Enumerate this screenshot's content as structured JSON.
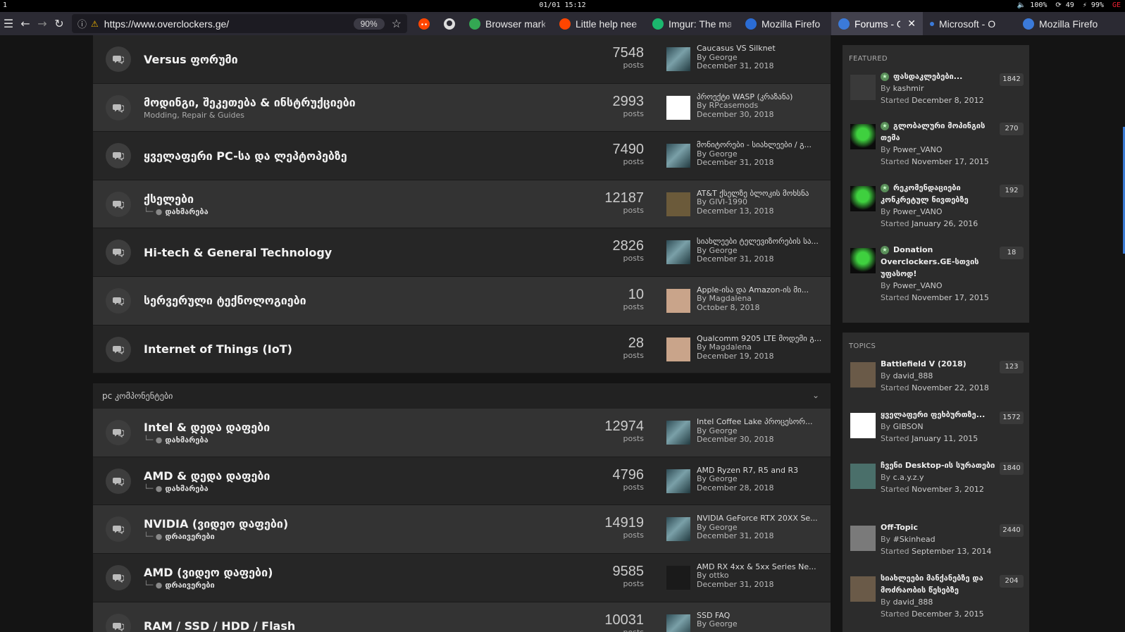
{
  "system": {
    "workspace": "1",
    "clock": "01/01 15:12",
    "volume": "🔈 100%",
    "updates": "⟳ 49",
    "battery": "⚡ 99%",
    "layout": "GE"
  },
  "browser": {
    "url": "https://www.overclockers.ge/",
    "zoom": "90%",
    "tabs": [
      {
        "label": "Browser mark",
        "color": "#34a853",
        "active": false
      },
      {
        "label": "Little help nee",
        "color": "#ff4500",
        "active": false
      },
      {
        "label": "Imgur: The ma",
        "color": "#1bb76e",
        "active": false
      },
      {
        "label": "Mozilla Firefo",
        "color": "#2b6cd4",
        "active": false
      },
      {
        "label": "Forums - O",
        "color": "#3b7ad9",
        "active": true
      },
      {
        "label": "Microsoft - O",
        "color": "#2b2a33",
        "active": false
      },
      {
        "label": "Mozilla Firefo",
        "color": "#3b7ad9",
        "active": false
      }
    ]
  },
  "forums": [
    {
      "title": "Versus ფორუმი",
      "sub": "",
      "subforum": "",
      "count": "7548",
      "count_label": "posts",
      "last_title": "Caucasus VS Silknet",
      "last_by": "By George",
      "last_date": "December 31, 2018",
      "avatar": "#5a7f86"
    },
    {
      "title": "მოდინგი, შეკეთება & ინსტრუქციები",
      "sub": "Modding, Repair & Guides",
      "subforum": "",
      "count": "2993",
      "count_label": "posts",
      "last_title": "პროექტი WASP (კრაზანა)",
      "last_by": "By RPcasemods",
      "last_date": "December 30, 2018",
      "avatar": "#ffffff"
    },
    {
      "title": "ყველაფერი PC-სა და ლეპტოპებზე",
      "sub": "",
      "subforum": "",
      "count": "7490",
      "count_label": "posts",
      "last_title": "მონიტორები - სიახლეები / გ...",
      "last_by": "By George",
      "last_date": "December 31, 2018",
      "avatar": "#5a7f86"
    },
    {
      "title": "ქსელები",
      "sub": "",
      "subforum": "დახმარება",
      "count": "12187",
      "count_label": "posts",
      "last_title": "AT&T ქსელზე ბლოკის მოხსნა",
      "last_by": "By GIVI-1990",
      "last_date": "December 13, 2018",
      "avatar": "#6b5a3a"
    },
    {
      "title": "Hi-tech & General Technology",
      "sub": "",
      "subforum": "",
      "count": "2826",
      "count_label": "posts",
      "last_title": "სიახლეები ტელევიზორების სა...",
      "last_by": "By George",
      "last_date": "December 31, 2018",
      "avatar": "#5a7f86"
    },
    {
      "title": "სერვერული ტექნოლოგიები",
      "sub": "",
      "subforum": "",
      "count": "10",
      "count_label": "posts",
      "last_title": "Apple-ისა და Amazon-ის მი...",
      "last_by": "By Magdalena",
      "last_date": "October 8, 2018",
      "avatar": "#c9a48a"
    },
    {
      "title": "Internet of Things (IoT)",
      "sub": "",
      "subforum": "",
      "count": "28",
      "count_label": "posts",
      "last_title": "Qualcomm 9205 LTE მოდემი გ...",
      "last_by": "By Magdalena",
      "last_date": "December 19, 2018",
      "avatar": "#c9a48a"
    }
  ],
  "category": {
    "title": "pc კომპონენტები"
  },
  "forums2": [
    {
      "title": "Intel & დედა დაფები",
      "sub": "",
      "subforum": "დახმარება",
      "count": "12974",
      "count_label": "posts",
      "last_title": "Intel Coffee Lake პროცესორ...",
      "last_by": "By George",
      "last_date": "December 30, 2018",
      "avatar": "#5a7f86"
    },
    {
      "title": "AMD & დედა დაფები",
      "sub": "",
      "subforum": "დახმარება",
      "count": "4796",
      "count_label": "posts",
      "last_title": "AMD Ryzen R7, R5 and R3",
      "last_by": "By George",
      "last_date": "December 28, 2018",
      "avatar": "#5a7f86"
    },
    {
      "title": "NVIDIA (ვიდეო დაფები)",
      "sub": "",
      "subforum": "დრაივერები",
      "count": "14919",
      "count_label": "posts",
      "last_title": "NVIDIA GeForce RTX 20XX Se...",
      "last_by": "By George",
      "last_date": "December 31, 2018",
      "avatar": "#5a7f86"
    },
    {
      "title": "AMD (ვიდეო დაფები)",
      "sub": "",
      "subforum": "დრაივერები",
      "count": "9585",
      "count_label": "posts",
      "last_title": "AMD RX 4xx & 5xx Series Ne...",
      "last_by": "By ottko",
      "last_date": "December 31, 2018",
      "avatar": "#1a1a1a"
    },
    {
      "title": "RAM / SSD / HDD / Flash",
      "sub": "",
      "subforum": "",
      "count": "10031",
      "count_label": "posts",
      "last_title": "SSD FAQ",
      "last_by": "By George",
      "last_date": "",
      "avatar": "#5a7f86"
    }
  ],
  "featured": {
    "heading": "FEATURED",
    "items": [
      {
        "title": "ფასდაკლებები...",
        "by": "kashmir",
        "started": "December 8, 2012",
        "count": "1842",
        "avatar": "#3a3a3a"
      },
      {
        "title": "გლობალური მოპინგის თემა",
        "by": "Power_VANO",
        "started": "November 17, 2015",
        "count": "270",
        "avatar": "#2faa2f"
      },
      {
        "title": "რეკომენდაციები კონკრეტულ ნივთებზე",
        "by": "Power_VANO",
        "started": "January 26, 2016",
        "count": "192",
        "avatar": "#2faa2f"
      },
      {
        "title": "Donation Overclockers.GE-სთვის უფასოდ!",
        "by": "Power_VANO",
        "started": "November 17, 2015",
        "count": "18",
        "avatar": "#2faa2f"
      }
    ]
  },
  "topics": {
    "heading": "TOPICS",
    "items": [
      {
        "title": "Battlefield V (2018)",
        "by": "david_888",
        "started": "November 22, 2018",
        "count": "123",
        "avatar": "#6a5a48"
      },
      {
        "title": "ყველაფერი ფეხბურთზე...",
        "by": "GIBSON",
        "started": "January 11, 2015",
        "count": "1572",
        "avatar": "#ffffff"
      },
      {
        "title": "ჩვენი Desktop-ის სურათები",
        "by": "c.a.y.z.y",
        "started": "November 3, 2012",
        "count": "1840",
        "avatar": "#4a6f6a"
      },
      {
        "title": "Off-Topic",
        "by": "#Skinhead",
        "started": "September 13, 2014",
        "count": "2440",
        "avatar": "#7a7a7a"
      },
      {
        "title": "სიახლეები მანქანებზე და მოძრაობის წესებზე",
        "by": "david_888",
        "started": "December 3, 2015",
        "count": "204",
        "avatar": "#6a5a48"
      }
    ]
  },
  "labels": {
    "by": "By",
    "started": "Started"
  }
}
